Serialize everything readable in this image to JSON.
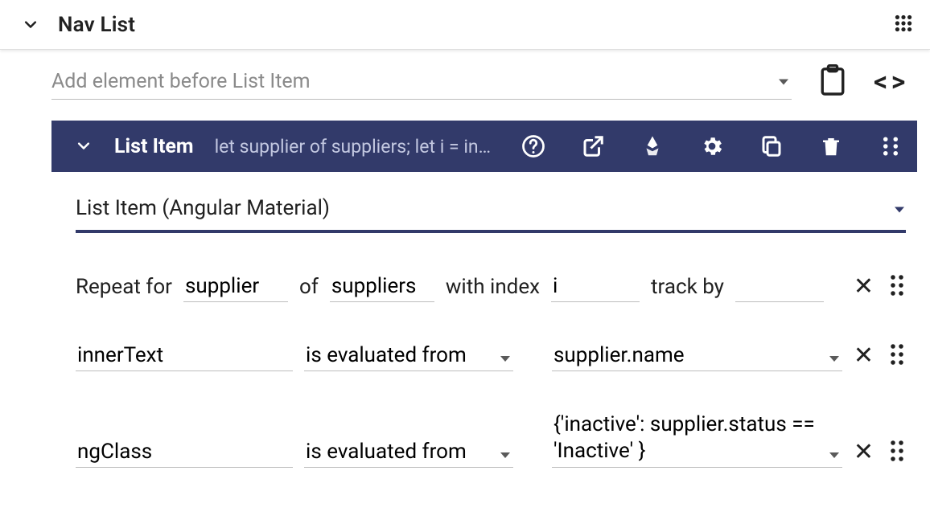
{
  "header": {
    "title": "Nav List"
  },
  "add_element": {
    "placeholder": "Add element before List Item"
  },
  "list_item": {
    "title": "List Item",
    "subtitle": "let supplier of suppliers; let i = in…",
    "component_type": "List Item (Angular Material)"
  },
  "repeat": {
    "label_repeat_for": "Repeat for",
    "var": "supplier",
    "label_of": "of",
    "collection": "suppliers",
    "label_with_index": "with index",
    "index": "i",
    "label_track_by": "track by",
    "track_by": ""
  },
  "bindings": [
    {
      "property": "innerText",
      "mode": "is evaluated from",
      "expression": "supplier.name"
    },
    {
      "property": "ngClass",
      "mode": "is evaluated from",
      "expression": "{'inactive': supplier.status == 'Inactive' }"
    }
  ]
}
